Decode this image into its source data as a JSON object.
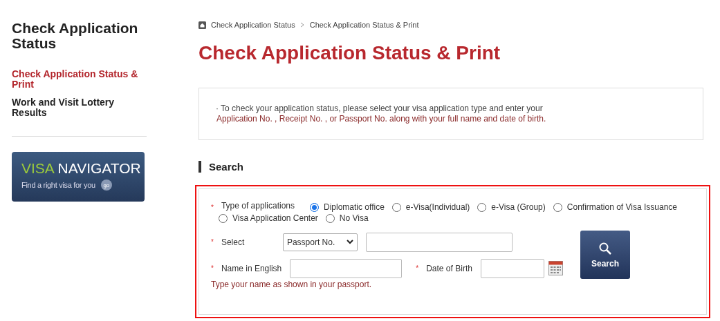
{
  "sidebar": {
    "title": "Check Application Status",
    "items": [
      {
        "label": "Check Application Status & Print",
        "selected": true
      },
      {
        "label": "Work and Visit Lottery Results",
        "selected": false
      }
    ],
    "banner": {
      "brand_first": "VISA",
      "brand_second": "NAVIGATOR",
      "tagline": "Find a right visa for you",
      "go": "go"
    }
  },
  "breadcrumb": [
    "Check Application Status",
    "Check Application Status & Print"
  ],
  "page_title": "Check Application Status & Print",
  "notice": {
    "line1": "· To check your application status, please select your visa application type and enter your",
    "line2": "Application No. , Receipt No. , or Passport No. along with your full name and date of birth."
  },
  "search": {
    "heading": "Search",
    "required_mark": "*",
    "type_label": "Type of applications",
    "options": [
      {
        "label": "Diplomatic office",
        "selected": true
      },
      {
        "label": "e-Visa(Individual)",
        "selected": false
      },
      {
        "label": "e-Visa (Group)",
        "selected": false
      },
      {
        "label": "Confirmation of Visa Issuance",
        "selected": false
      },
      {
        "label": "Visa Application Center",
        "selected": false
      },
      {
        "label": "No Visa",
        "selected": false
      }
    ],
    "select_label": "Select",
    "select_value": "Passport No.",
    "name_label": "Name in English",
    "dob_label": "Date of Birth",
    "hint": "Type your name as shown in your passport.",
    "button": "Search"
  }
}
